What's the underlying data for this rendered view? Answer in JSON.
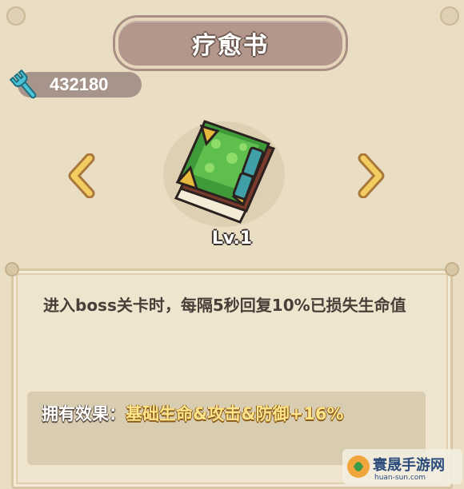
{
  "title": "疗愈书",
  "currency": {
    "icon": "wrench-icon",
    "amount": "432180"
  },
  "item": {
    "name": "疗愈书",
    "icon": "green-book-icon",
    "level": "Lv.1"
  },
  "navigation": {
    "prev_icon": "chevron-left-icon",
    "next_icon": "chevron-right-icon"
  },
  "description": "进入boss关卡时，每隔5秒回复10%已损失生命值",
  "effect": {
    "label": "拥有效果：",
    "value": "基础生命&攻击&防御+16%"
  },
  "watermark": {
    "text": "寰晟手游网",
    "sub": "huan-sun.com"
  },
  "colors": {
    "title_plate": "#b3978c",
    "background": "#e9ddc4",
    "effect_value": "#ffe48a",
    "arrow": "#e8b94a"
  }
}
